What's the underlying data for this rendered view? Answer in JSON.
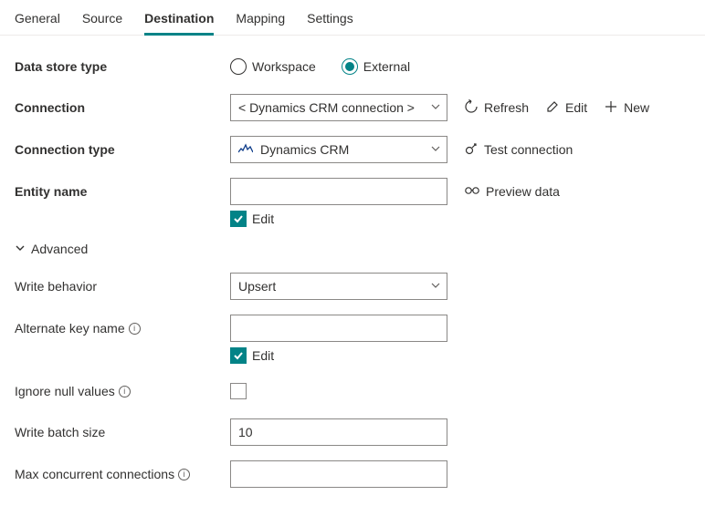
{
  "tabs": {
    "general": "General",
    "source": "Source",
    "destination": "Destination",
    "mapping": "Mapping",
    "settings": "Settings"
  },
  "labels": {
    "data_store_type": "Data store type",
    "connection": "Connection",
    "connection_type": "Connection type",
    "entity_name": "Entity name",
    "advanced": "Advanced",
    "write_behavior": "Write behavior",
    "alternate_key_name": "Alternate key name",
    "ignore_null_values": "Ignore null values",
    "write_batch_size": "Write batch size",
    "max_concurrent_connections": "Max concurrent connections",
    "edit_checkbox": "Edit"
  },
  "options": {
    "workspace": "Workspace",
    "external": "External"
  },
  "fields": {
    "connection_value": "< Dynamics CRM connection >",
    "connection_type_value": "Dynamics CRM",
    "entity_name_value": "",
    "write_behavior_value": "Upsert",
    "alternate_key_name_value": "",
    "write_batch_size_value": "10",
    "max_concurrent_connections_value": ""
  },
  "actions": {
    "refresh": "Refresh",
    "edit": "Edit",
    "new": "New",
    "test_connection": "Test connection",
    "preview_data": "Preview data"
  }
}
